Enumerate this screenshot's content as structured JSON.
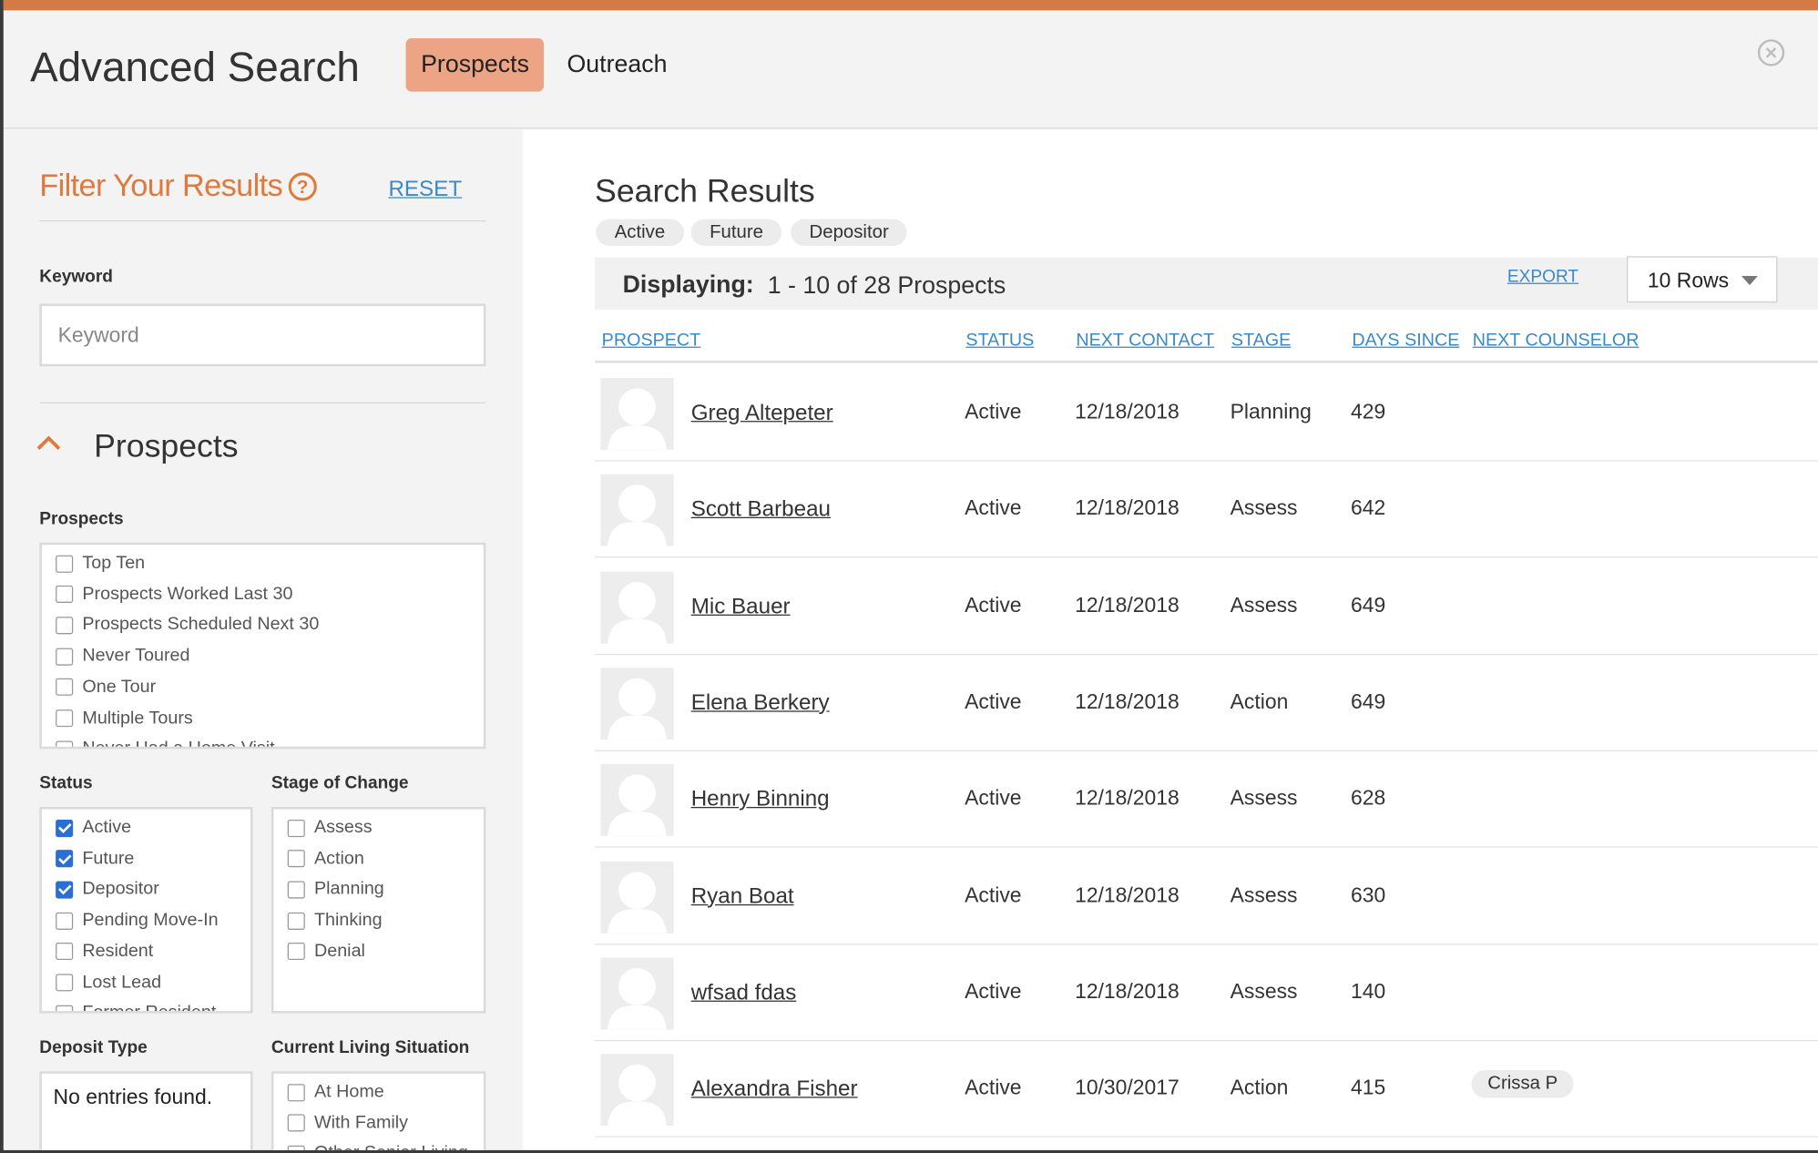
{
  "header": {
    "title": "Advanced Search",
    "tabs": [
      {
        "label": "Prospects",
        "active": true
      },
      {
        "label": "Outreach",
        "active": false
      }
    ]
  },
  "filter": {
    "title": "Filter Your Results",
    "reset": "RESET",
    "keyword_label": "Keyword",
    "keyword_placeholder": "Keyword",
    "keyword_value": "",
    "section_title": "Prospects",
    "prospects_label": "Prospects",
    "prospects_options": [
      {
        "label": "Top Ten",
        "checked": false
      },
      {
        "label": "Prospects Worked Last 30",
        "checked": false
      },
      {
        "label": "Prospects Scheduled Next 30",
        "checked": false
      },
      {
        "label": "Never Toured",
        "checked": false
      },
      {
        "label": "One Tour",
        "checked": false
      },
      {
        "label": "Multiple Tours",
        "checked": false
      },
      {
        "label": "Never Had a Home Visit",
        "checked": false
      }
    ],
    "status_label": "Status",
    "status_options": [
      {
        "label": "Active",
        "checked": true
      },
      {
        "label": "Future",
        "checked": true
      },
      {
        "label": "Depositor",
        "checked": true
      },
      {
        "label": "Pending Move-In",
        "checked": false
      },
      {
        "label": "Resident",
        "checked": false
      },
      {
        "label": "Lost Lead",
        "checked": false
      },
      {
        "label": "Former Resident",
        "checked": false
      }
    ],
    "stage_label": "Stage of Change",
    "stage_options": [
      {
        "label": "Assess",
        "checked": false
      },
      {
        "label": "Action",
        "checked": false
      },
      {
        "label": "Planning",
        "checked": false
      },
      {
        "label": "Thinking",
        "checked": false
      },
      {
        "label": "Denial",
        "checked": false
      }
    ],
    "deposit_label": "Deposit Type",
    "deposit_empty": "No entries found.",
    "living_label": "Current Living Situation",
    "living_options": [
      {
        "label": "At Home",
        "checked": false
      },
      {
        "label": "With Family",
        "checked": false
      },
      {
        "label": "Other Senior Living",
        "checked": false
      }
    ]
  },
  "results": {
    "title": "Search Results",
    "chips": [
      "Active",
      "Future",
      "Depositor"
    ],
    "displaying_label": "Displaying:",
    "displaying_value": "1 - 10 of 28 Prospects",
    "export": "EXPORT",
    "rows_select": "10 Rows",
    "columns": [
      "PROSPECT",
      "STATUS",
      "NEXT CONTACT",
      "STAGE",
      "DAYS SINCE",
      "NEXT COUNSELOR"
    ],
    "rows": [
      {
        "name": "Greg Altepeter",
        "status": "Active",
        "next_contact": "12/18/2018",
        "stage": "Planning",
        "days_since": "429",
        "counselor": ""
      },
      {
        "name": "Scott Barbeau",
        "status": "Active",
        "next_contact": "12/18/2018",
        "stage": "Assess",
        "days_since": "642",
        "counselor": ""
      },
      {
        "name": "Mic Bauer",
        "status": "Active",
        "next_contact": "12/18/2018",
        "stage": "Assess",
        "days_since": "649",
        "counselor": ""
      },
      {
        "name": "Elena Berkery",
        "status": "Active",
        "next_contact": "12/18/2018",
        "stage": "Action",
        "days_since": "649",
        "counselor": ""
      },
      {
        "name": "Henry Binning",
        "status": "Active",
        "next_contact": "12/18/2018",
        "stage": "Assess",
        "days_since": "628",
        "counselor": ""
      },
      {
        "name": "Ryan Boat",
        "status": "Active",
        "next_contact": "12/18/2018",
        "stage": "Assess",
        "days_since": "630",
        "counselor": ""
      },
      {
        "name": "wfsad fdas",
        "status": "Active",
        "next_contact": "12/18/2018",
        "stage": "Assess",
        "days_since": "140",
        "counselor": ""
      },
      {
        "name": "Alexandra Fisher",
        "status": "Active",
        "next_contact": "10/30/2017",
        "stage": "Action",
        "days_since": "415",
        "counselor": "Crissa P"
      }
    ]
  },
  "colors": {
    "accent": "#d67a45",
    "active_tab": "#eca485",
    "filter_title": "#e07a3c",
    "link": "#3a8ac8",
    "checkbox": "#2a6fd6"
  },
  "icons": {
    "close": "close-icon",
    "help": "help-icon",
    "collapse": "chevron-up-icon",
    "dropdown": "caret-down-icon",
    "avatar": "avatar-placeholder-icon"
  }
}
